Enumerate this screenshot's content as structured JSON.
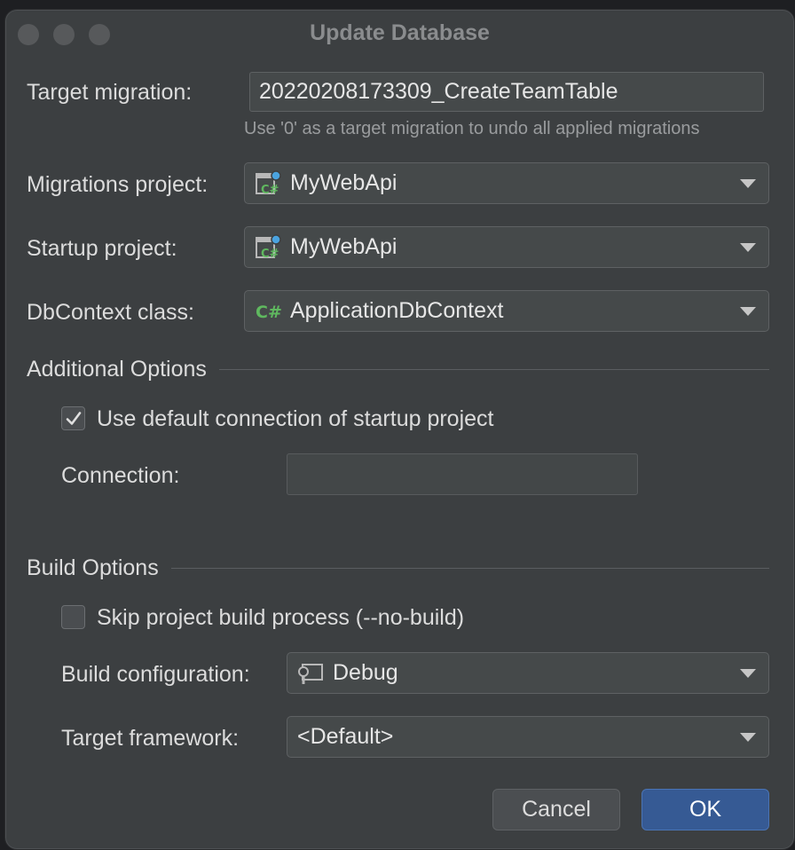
{
  "window": {
    "title": "Update Database"
  },
  "target_migration": {
    "label": "Target migration:",
    "value": "20220208173309_CreateTeamTable",
    "hint": "Use '0' as a target migration to undo all applied migrations"
  },
  "migrations_project": {
    "label": "Migrations project:",
    "value": "MyWebApi"
  },
  "startup_project": {
    "label": "Startup project:",
    "value": "MyWebApi"
  },
  "dbcontext": {
    "label": "DbContext class:",
    "value": "ApplicationDbContext"
  },
  "additional_options": {
    "header": "Additional Options",
    "use_default_connection": {
      "label": "Use default connection of startup project",
      "checked": true
    },
    "connection": {
      "label": "Connection:",
      "value": ""
    }
  },
  "build_options": {
    "header": "Build Options",
    "skip_build": {
      "label": "Skip project build process (--no-build)",
      "checked": false
    },
    "build_configuration": {
      "label": "Build configuration:",
      "value": "Debug"
    },
    "target_framework": {
      "label": "Target framework:",
      "value": "<Default>"
    }
  },
  "buttons": {
    "cancel": "Cancel",
    "ok": "OK"
  },
  "colors": {
    "accent": "#365a94",
    "csharp_green": "#5fb85f",
    "background": "#3c3f41"
  },
  "icons": {
    "project": "csharp-project-icon",
    "class": "csharp-class-icon",
    "config": "run-configuration-icon"
  }
}
